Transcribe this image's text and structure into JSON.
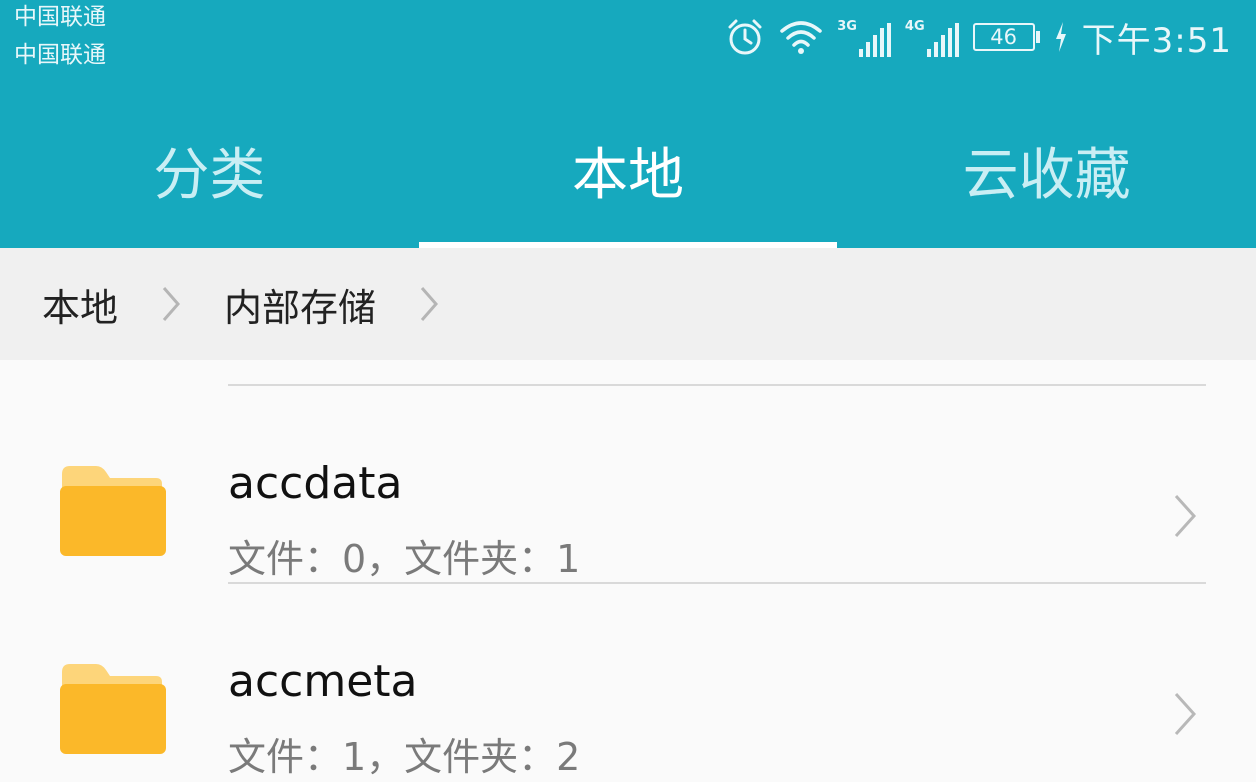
{
  "status_bar": {
    "carriers": [
      "中国联通",
      "中国联通"
    ],
    "network1": "3G",
    "network2": "4G",
    "battery": "46",
    "time": "下午3:51",
    "icons": [
      "alarm-icon",
      "wifi-icon",
      "signal-icon",
      "signal-icon",
      "battery-icon",
      "charging-icon"
    ]
  },
  "tabs": [
    {
      "label": "分类",
      "active": false
    },
    {
      "label": "本地",
      "active": true
    },
    {
      "label": "云收藏",
      "active": false
    }
  ],
  "breadcrumb": [
    "本地",
    "内部存储"
  ],
  "files": [
    {
      "name": "accdata",
      "info": "文件：0，文件夹：1"
    },
    {
      "name": "accmeta",
      "info": "文件：1，文件夹：2"
    }
  ],
  "colors": {
    "header": "#16a9be",
    "folder": "#fbb829",
    "folder_tab": "#fdd57a"
  }
}
